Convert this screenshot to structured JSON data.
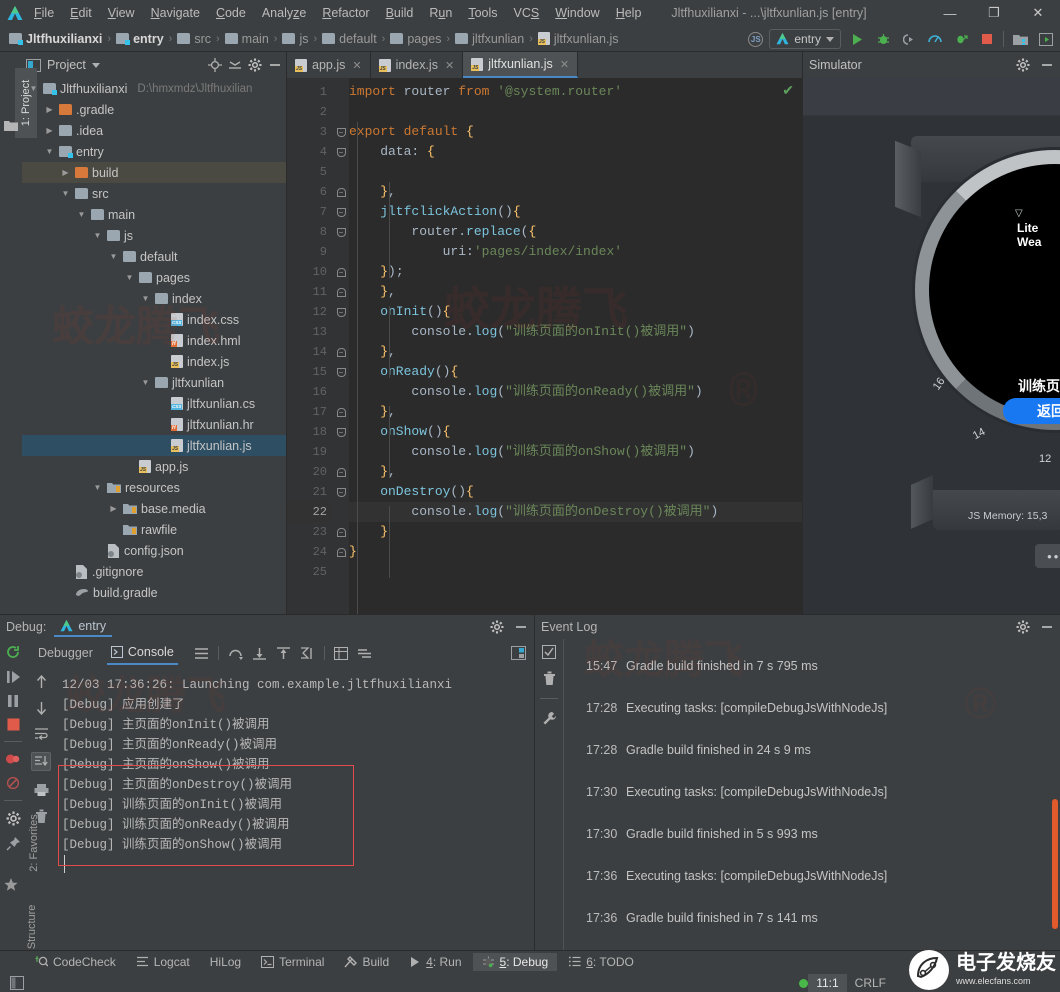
{
  "window": {
    "title": "Jltfhuxilianxi - ...\\jltfxunlian.js [entry]",
    "minimize": "—",
    "maximize": "❐",
    "close": "✕"
  },
  "menu": {
    "logo_icon": "deveco-logo-icon",
    "items": [
      "File",
      "Edit",
      "View",
      "Navigate",
      "Code",
      "Analyze",
      "Refactor",
      "Build",
      "Run",
      "Tools",
      "VCS",
      "Window",
      "Help"
    ]
  },
  "breadcrumb": {
    "separator": "›",
    "items": [
      {
        "label": "Jltfhuxilianxi",
        "icon": "module-folder-icon",
        "bold": true
      },
      {
        "label": "entry",
        "icon": "module-folder-icon",
        "bold": true
      },
      {
        "label": "src",
        "icon": "folder-icon",
        "bold": false
      },
      {
        "label": "main",
        "icon": "folder-icon",
        "bold": false
      },
      {
        "label": "js",
        "icon": "folder-icon",
        "bold": false
      },
      {
        "label": "default",
        "icon": "folder-icon",
        "bold": false
      },
      {
        "label": "pages",
        "icon": "folder-icon",
        "bold": false
      },
      {
        "label": "jltfxunlian",
        "icon": "folder-icon",
        "bold": false
      },
      {
        "label": "jltfxunlian.js",
        "icon": "js-file-icon",
        "bold": false
      }
    ]
  },
  "toolbar": {
    "js_badge": "JS",
    "run_config": "entry",
    "run_config_caret": "▼",
    "buttons": [
      "run-icon",
      "debug-icon",
      "attach-debugger-icon",
      "profiler-icon",
      "run-with-coverage-icon",
      "stop-icon",
      "project-structure-icon",
      "preview-icon"
    ]
  },
  "left_rail": {
    "items": [
      {
        "label": "1: Project",
        "active": true,
        "icon": "project-icon"
      },
      {
        "label": "2: Favorites",
        "active": false,
        "icon": "star-icon"
      },
      {
        "label": "7: Structure",
        "active": false,
        "icon": "structure-icon"
      }
    ]
  },
  "project_panel": {
    "title": "Project",
    "title_caret": "▼",
    "icons": [
      "locate-icon",
      "collapse-all-icon",
      "gear-icon",
      "hide-icon"
    ],
    "tree": [
      {
        "depth": 0,
        "arrow": "▼",
        "label": "Jltfhuxilianxi",
        "path": "D:\\hmxmdz\\Jltfhuxilian",
        "icon": "module-folder-icon",
        "state": "normal"
      },
      {
        "depth": 1,
        "arrow": "▶",
        "label": ".gradle",
        "icon": "folder-orange-icon",
        "state": "normal"
      },
      {
        "depth": 1,
        "arrow": "▶",
        "label": ".idea",
        "icon": "folder-icon",
        "state": "normal"
      },
      {
        "depth": 1,
        "arrow": "▼",
        "label": "entry",
        "icon": "module-folder-icon",
        "state": "normal"
      },
      {
        "depth": 2,
        "arrow": "▶",
        "label": "build",
        "icon": "folder-orange-icon",
        "state": "highlight"
      },
      {
        "depth": 2,
        "arrow": "▼",
        "label": "src",
        "icon": "folder-icon",
        "state": "normal"
      },
      {
        "depth": 3,
        "arrow": "▼",
        "label": "main",
        "icon": "folder-icon",
        "state": "normal"
      },
      {
        "depth": 4,
        "arrow": "▼",
        "label": "js",
        "icon": "folder-icon",
        "state": "normal"
      },
      {
        "depth": 5,
        "arrow": "▼",
        "label": "default",
        "icon": "folder-icon",
        "state": "normal"
      },
      {
        "depth": 6,
        "arrow": "▼",
        "label": "pages",
        "icon": "folder-icon",
        "state": "normal"
      },
      {
        "depth": 7,
        "arrow": "▼",
        "label": "index",
        "icon": "folder-icon",
        "state": "normal"
      },
      {
        "depth": 8,
        "arrow": "",
        "label": "index.css",
        "icon": "css-file-icon",
        "state": "normal"
      },
      {
        "depth": 8,
        "arrow": "",
        "label": "index.hml",
        "icon": "hml-file-icon",
        "state": "normal"
      },
      {
        "depth": 8,
        "arrow": "",
        "label": "index.js",
        "icon": "js-file-icon",
        "state": "normal"
      },
      {
        "depth": 7,
        "arrow": "▼",
        "label": "jltfxunlian",
        "icon": "folder-icon",
        "state": "normal"
      },
      {
        "depth": 8,
        "arrow": "",
        "label": "jltfxunlian.cs",
        "icon": "css-file-icon",
        "state": "normal"
      },
      {
        "depth": 8,
        "arrow": "",
        "label": "jltfxunlian.hr",
        "icon": "hml-file-icon",
        "state": "normal"
      },
      {
        "depth": 8,
        "arrow": "",
        "label": "jltfxunlian.js",
        "icon": "js-file-icon",
        "state": "selected"
      },
      {
        "depth": 6,
        "arrow": "",
        "label": "app.js",
        "icon": "js-file-icon",
        "state": "normal"
      },
      {
        "depth": 4,
        "arrow": "▼",
        "label": "resources",
        "icon": "resources-folder-icon",
        "state": "normal"
      },
      {
        "depth": 5,
        "arrow": "▶",
        "label": "base.media",
        "icon": "res-folder-icon",
        "state": "normal"
      },
      {
        "depth": 5,
        "arrow": "",
        "label": "rawfile",
        "icon": "res-folder-icon",
        "state": "normal"
      },
      {
        "depth": 4,
        "arrow": "",
        "label": "config.json",
        "icon": "json-file-icon",
        "state": "normal"
      },
      {
        "depth": 2,
        "arrow": "",
        "label": ".gitignore",
        "icon": "gitignore-file-icon",
        "state": "normal"
      },
      {
        "depth": 2,
        "arrow": "",
        "label": "build.gradle",
        "icon": "gradle-file-icon",
        "state": "normal"
      }
    ]
  },
  "editor": {
    "tabs": [
      {
        "label": "app.js",
        "icon": "js-file-icon",
        "active": false,
        "close": "✕"
      },
      {
        "label": "index.js",
        "icon": "js-file-icon",
        "active": false,
        "close": "✕"
      },
      {
        "label": "jltfxunlian.js",
        "icon": "js-file-icon",
        "active": true,
        "close": "✕"
      }
    ],
    "inspection_status_icon": "check-ok-icon",
    "current_line": 22,
    "line_count": 25,
    "lines": [
      {
        "n": 1,
        "fold": "",
        "tokens": [
          {
            "t": "import ",
            "c": "k"
          },
          {
            "t": "router ",
            "c": "m"
          },
          {
            "t": "from ",
            "c": "k"
          },
          {
            "t": "'@system.router'",
            "c": "s"
          }
        ]
      },
      {
        "n": 2,
        "fold": "",
        "tokens": []
      },
      {
        "n": 3,
        "fold": "down",
        "tokens": [
          {
            "t": "export default ",
            "c": "k"
          },
          {
            "t": "{",
            "c": "f"
          }
        ]
      },
      {
        "n": 4,
        "fold": "down",
        "tokens": [
          {
            "t": "    data",
            "c": "m"
          },
          {
            "t": ": ",
            "c": "p"
          },
          {
            "t": "{",
            "c": "f"
          }
        ]
      },
      {
        "n": 5,
        "fold": "",
        "tokens": []
      },
      {
        "n": 6,
        "fold": "up",
        "tokens": [
          {
            "t": "    ",
            "c": "m"
          },
          {
            "t": "}",
            "c": "f"
          },
          {
            "t": ",",
            "c": "p"
          }
        ]
      },
      {
        "n": 7,
        "fold": "down",
        "tokens": [
          {
            "t": "    jltfclickAction",
            "c": "fn"
          },
          {
            "t": "()",
            "c": "p"
          },
          {
            "t": "{",
            "c": "f"
          }
        ]
      },
      {
        "n": 8,
        "fold": "down",
        "tokens": [
          {
            "t": "        router",
            "c": "m"
          },
          {
            "t": ".",
            "c": "p"
          },
          {
            "t": "replace",
            "c": "fn"
          },
          {
            "t": "(",
            "c": "p"
          },
          {
            "t": "{",
            "c": "f"
          }
        ]
      },
      {
        "n": 9,
        "fold": "",
        "tokens": [
          {
            "t": "            uri",
            "c": "m"
          },
          {
            "t": ":",
            "c": "p"
          },
          {
            "t": "'pages/index/index'",
            "c": "s"
          }
        ]
      },
      {
        "n": 10,
        "fold": "up",
        "tokens": [
          {
            "t": "    ",
            "c": "m"
          },
          {
            "t": "}",
            "c": "f"
          },
          {
            "t": ")",
            "c": "p"
          },
          {
            "t": ";",
            "c": "p"
          }
        ]
      },
      {
        "n": 11,
        "fold": "up",
        "tokens": [
          {
            "t": "    ",
            "c": "m"
          },
          {
            "t": "}",
            "c": "f"
          },
          {
            "t": ",",
            "c": "p"
          }
        ]
      },
      {
        "n": 12,
        "fold": "down",
        "tokens": [
          {
            "t": "    onInit",
            "c": "fn"
          },
          {
            "t": "()",
            "c": "p"
          },
          {
            "t": "{",
            "c": "f"
          }
        ]
      },
      {
        "n": 13,
        "fold": "",
        "tokens": [
          {
            "t": "        console",
            "c": "m"
          },
          {
            "t": ".",
            "c": "p"
          },
          {
            "t": "log",
            "c": "fn"
          },
          {
            "t": "(",
            "c": "p"
          },
          {
            "t": "\"训练页面的onInit()被调用\"",
            "c": "s"
          },
          {
            "t": ")",
            "c": "p"
          }
        ]
      },
      {
        "n": 14,
        "fold": "up",
        "tokens": [
          {
            "t": "    ",
            "c": "m"
          },
          {
            "t": "}",
            "c": "f"
          },
          {
            "t": ",",
            "c": "p"
          }
        ]
      },
      {
        "n": 15,
        "fold": "down",
        "tokens": [
          {
            "t": "    onReady",
            "c": "fn"
          },
          {
            "t": "()",
            "c": "p"
          },
          {
            "t": "{",
            "c": "f"
          }
        ]
      },
      {
        "n": 16,
        "fold": "",
        "tokens": [
          {
            "t": "        console",
            "c": "m"
          },
          {
            "t": ".",
            "c": "p"
          },
          {
            "t": "log",
            "c": "fn"
          },
          {
            "t": "(",
            "c": "p"
          },
          {
            "t": "\"训练页面的onReady()被调用\"",
            "c": "s"
          },
          {
            "t": ")",
            "c": "p"
          }
        ]
      },
      {
        "n": 17,
        "fold": "up",
        "tokens": [
          {
            "t": "    ",
            "c": "m"
          },
          {
            "t": "}",
            "c": "f"
          },
          {
            "t": ",",
            "c": "p"
          }
        ]
      },
      {
        "n": 18,
        "fold": "down",
        "tokens": [
          {
            "t": "    onShow",
            "c": "fn"
          },
          {
            "t": "()",
            "c": "p"
          },
          {
            "t": "{",
            "c": "f"
          }
        ]
      },
      {
        "n": 19,
        "fold": "",
        "tokens": [
          {
            "t": "        console",
            "c": "m"
          },
          {
            "t": ".",
            "c": "p"
          },
          {
            "t": "log",
            "c": "fn"
          },
          {
            "t": "(",
            "c": "p"
          },
          {
            "t": "\"训练页面的onShow()被调用\"",
            "c": "s"
          },
          {
            "t": ")",
            "c": "p"
          }
        ]
      },
      {
        "n": 20,
        "fold": "up",
        "tokens": [
          {
            "t": "    ",
            "c": "m"
          },
          {
            "t": "}",
            "c": "f"
          },
          {
            "t": ",",
            "c": "p"
          }
        ]
      },
      {
        "n": 21,
        "fold": "down",
        "tokens": [
          {
            "t": "    onDestroy",
            "c": "fn"
          },
          {
            "t": "()",
            "c": "p"
          },
          {
            "t": "{",
            "c": "f"
          }
        ]
      },
      {
        "n": 22,
        "fold": "",
        "tokens": [
          {
            "t": "        console",
            "c": "m"
          },
          {
            "t": ".",
            "c": "p"
          },
          {
            "t": "log",
            "c": "fn"
          },
          {
            "t": "(",
            "c": "p"
          },
          {
            "t": "\"训练页面的onDestroy()被调用\"",
            "c": "s"
          },
          {
            "t": ")",
            "c": "p"
          }
        ]
      },
      {
        "n": 23,
        "fold": "up",
        "tokens": [
          {
            "t": "    ",
            "c": "m"
          },
          {
            "t": "}",
            "c": "f"
          }
        ]
      },
      {
        "n": 24,
        "fold": "up",
        "tokens": [
          {
            "t": "}",
            "c": "f"
          }
        ]
      },
      {
        "n": 25,
        "fold": "",
        "tokens": []
      }
    ]
  },
  "simulator": {
    "title": "Simulator",
    "icons": [
      "gear-icon",
      "hide-icon"
    ],
    "device_label": "Lite Wea",
    "screen_title": "训练页",
    "screen_button": "返回",
    "js_memory": "JS Memory: 15,3",
    "more_button": "•••"
  },
  "debug_panel": {
    "header_label": "Debug:",
    "config_name": "entry",
    "header_icons": [
      "gear-icon",
      "hide-icon"
    ],
    "tabs": [
      {
        "label": "Debugger",
        "active": false,
        "icon": "debugger-icon"
      },
      {
        "label": "Console",
        "active": true,
        "icon": "console-icon"
      }
    ],
    "toolbar_icons": [
      "menu-icon",
      "step-over-icon",
      "step-into-icon",
      "step-out-icon",
      "run-to-cursor-icon",
      "evaluate-icon",
      "settings-icon",
      "layout-icon"
    ],
    "side_icons": [
      "rerun-icon",
      "resume-icon",
      "pause-icon",
      "stop-icon",
      "view-breakpoints-icon",
      "mute-breakpoints-icon",
      "settings-gear-icon",
      "pin-icon"
    ],
    "console_side_icons": [
      "scroll-up-icon",
      "scroll-down-icon",
      "soft-wrap-icon",
      "scroll-to-end-icon",
      "print-icon",
      "clear-all-icon"
    ],
    "console_lines": [
      {
        "text": "12/03 17:36:26: Launching com.example.jltfhuxilianxi",
        "highlight": false
      },
      {
        "text": "[Debug] 应用创建了",
        "highlight": false
      },
      {
        "text": "[Debug] 主页面的onInit()被调用",
        "highlight": false
      },
      {
        "text": "[Debug] 主页面的onReady()被调用",
        "highlight": false
      },
      {
        "text": "[Debug] 主页面的onShow()被调用",
        "highlight": false
      },
      {
        "text": "[Debug] 主页面的onDestroy()被调用",
        "highlight": true
      },
      {
        "text": "[Debug] 训练页面的onInit()被调用",
        "highlight": true
      },
      {
        "text": "[Debug] 训练页面的onReady()被调用",
        "highlight": true
      },
      {
        "text": "[Debug] 训练页面的onShow()被调用",
        "highlight": true
      },
      {
        "text": "|",
        "highlight": true
      }
    ],
    "highlight_color": "#e04b4b"
  },
  "event_log": {
    "title": "Event Log",
    "icons": [
      "gear-icon",
      "hide-icon"
    ],
    "side_icons": [
      "mark-read-icon",
      "clear-icon",
      "settings-wrench-icon"
    ],
    "entries": [
      {
        "time": "15:47",
        "text": "Gradle build finished in 7 s 795 ms"
      },
      {
        "time": "17:28",
        "text": "Executing tasks: [compileDebugJsWithNodeJs]"
      },
      {
        "time": "17:28",
        "text": "Gradle build finished in 24 s 9 ms"
      },
      {
        "time": "17:30",
        "text": "Executing tasks: [compileDebugJsWithNodeJs]"
      },
      {
        "time": "17:30",
        "text": "Gradle build finished in 5 s 993 ms"
      },
      {
        "time": "17:36",
        "text": "Executing tasks: [compileDebugJsWithNodeJs]"
      },
      {
        "time": "17:36",
        "text": "Gradle build finished in 7 s 141 ms"
      }
    ]
  },
  "tool_buttons": [
    {
      "label": "CodeCheck",
      "icon": "codecheck-icon",
      "active": false,
      "mnemonic": ""
    },
    {
      "label": "Logcat",
      "icon": "logcat-icon",
      "active": false,
      "mnemonic": ""
    },
    {
      "label": "HiLog",
      "icon": "",
      "active": false,
      "mnemonic": ""
    },
    {
      "label": "Terminal",
      "icon": "terminal-icon",
      "active": false,
      "mnemonic": ""
    },
    {
      "label": "Build",
      "icon": "build-icon",
      "active": false,
      "mnemonic": ""
    },
    {
      "label": "4: Run",
      "icon": "run-icon",
      "active": false,
      "mnemonic": "4"
    },
    {
      "label": "5: Debug",
      "icon": "debug-icon",
      "active": true,
      "mnemonic": "5"
    },
    {
      "label": "6: TODO",
      "icon": "todo-icon",
      "active": false,
      "mnemonic": "6"
    }
  ],
  "status_bar": {
    "left_icon": "toggle-toolwindow-icon",
    "caret_position": "11:1",
    "line_separator": "CRLF",
    "indicator": "green-dot"
  },
  "watermarks": {
    "brand_text": "蛟龙腾飞",
    "reg_mark": "®",
    "elecfans_cn": "电子发烧友",
    "elecfans_url": "www.elecfans.com"
  }
}
